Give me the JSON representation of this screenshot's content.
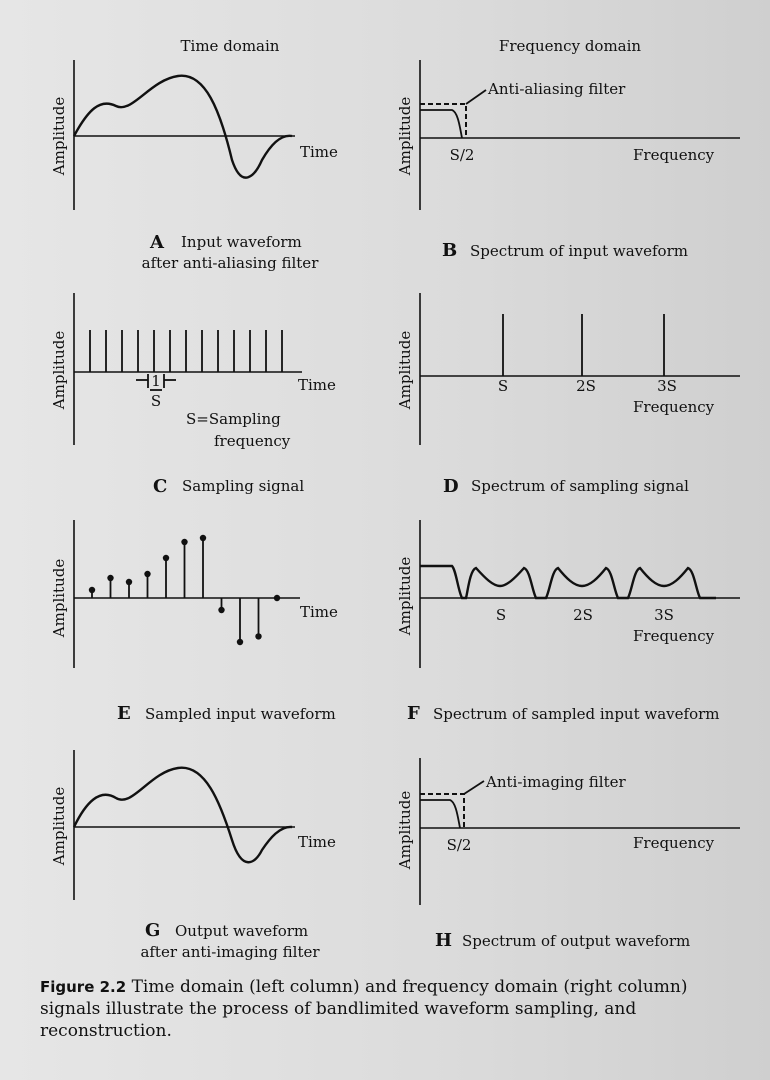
{
  "panels": {
    "A": {
      "header": "Time domain",
      "y_label": "Amplitude",
      "x_label": "Time",
      "letter": "A",
      "caption_line1": "Input waveform",
      "caption_line2": "after anti-aliasing filter"
    },
    "B": {
      "header": "Frequency domain",
      "y_label": "Amplitude",
      "annotation": "Anti-aliasing filter",
      "marker": "S/2",
      "x_label": "Frequency",
      "letter": "B",
      "caption": "Spectrum of input waveform"
    },
    "C": {
      "y_label": "Amplitude",
      "x_label": "Time",
      "interval_num": "1",
      "interval_den": "S",
      "definition_line1": "S=Sampling",
      "definition_line2": "frequency",
      "letter": "C",
      "caption": "Sampling signal"
    },
    "D": {
      "y_label": "Amplitude",
      "ticks": [
        "S",
        "2S",
        "3S"
      ],
      "x_label": "Frequency",
      "letter": "D",
      "caption": "Spectrum of sampling signal"
    },
    "E": {
      "y_label": "Amplitude",
      "x_label": "Time",
      "letter": "E",
      "caption": "Sampled input waveform"
    },
    "F": {
      "y_label": "Amplitude",
      "ticks": [
        "S",
        "2S",
        "3S"
      ],
      "x_label": "Frequency",
      "letter": "F",
      "caption": "Spectrum of sampled input waveform"
    },
    "G": {
      "y_label": "Amplitude",
      "x_label": "Time",
      "letter": "G",
      "caption_line1": "Output waveform",
      "caption_line2": "after anti-imaging filter"
    },
    "H": {
      "y_label": "Amplitude",
      "annotation": "Anti-imaging filter",
      "marker": "S/2",
      "x_label": "Frequency",
      "letter": "H",
      "caption": "Spectrum of output waveform"
    }
  },
  "figure_caption": {
    "label": "Figure 2.2",
    "text": "Time domain (left column) and frequency domain (right column) signals illustrate the process of bandlimited waveform sampling, and reconstruction."
  },
  "sampled_waveform_values": [
    0.1,
    0.25,
    0.2,
    0.3,
    0.5,
    0.7,
    0.75,
    -0.15,
    -0.55,
    -0.48,
    0.0
  ]
}
